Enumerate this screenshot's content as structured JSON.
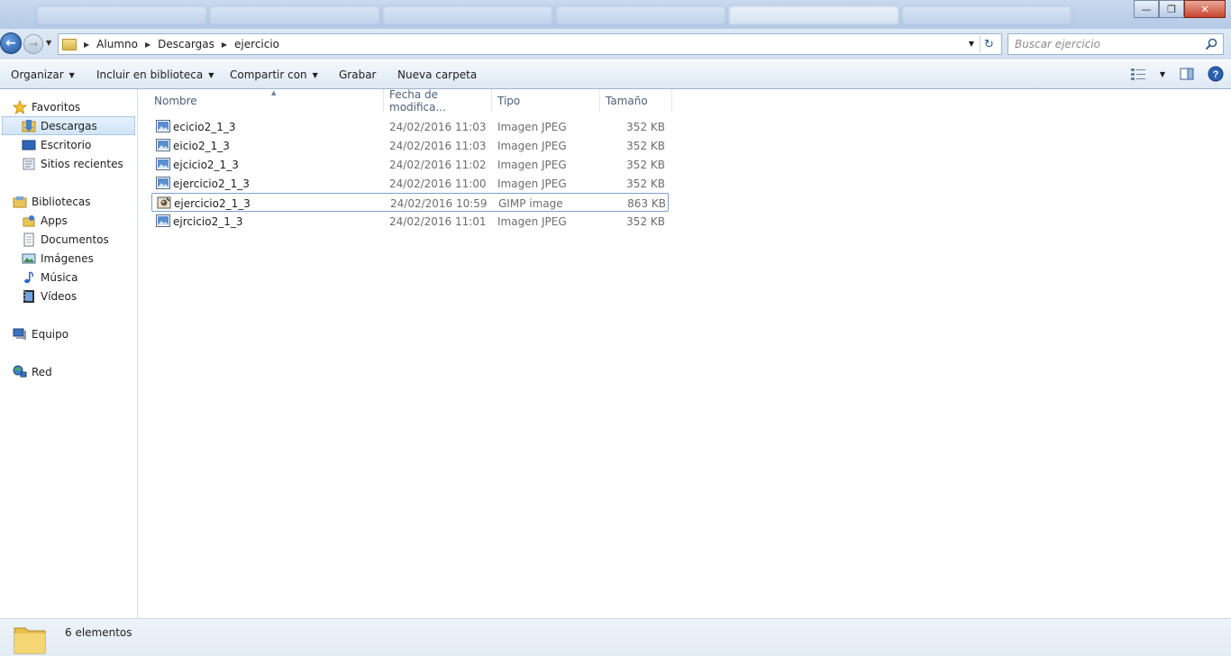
{
  "window": {
    "tabs": [
      "",
      "",
      "",
      "",
      "",
      "",
      "",
      ""
    ],
    "minimize": "—",
    "restore": "❐",
    "close": "✕"
  },
  "address": {
    "breadcrumbs": [
      "Alumno",
      "Descargas",
      "ejercicio"
    ],
    "search_placeholder": "Buscar ejercicio"
  },
  "toolbar": {
    "organize": "Organizar",
    "include_library": "Incluir en biblioteca",
    "share": "Compartir con",
    "burn": "Grabar",
    "new_folder": "Nueva carpeta"
  },
  "sidebar": {
    "favorites": "Favoritos",
    "downloads": "Descargas",
    "desktop": "Escritorio",
    "recent": "Sitios recientes",
    "libraries": "Bibliotecas",
    "apps": "Apps",
    "documents": "Documentos",
    "images": "Imágenes",
    "music": "Música",
    "videos": "Vídeos",
    "computer": "Equipo",
    "network": "Red"
  },
  "columns": {
    "name": "Nombre",
    "date": "Fecha de modifica...",
    "type": "Tipo",
    "size": "Tamaño"
  },
  "files": [
    {
      "name": "ecicio2_1_3",
      "date": "24/02/2016 11:03",
      "type": "Imagen JPEG",
      "size": "352 KB",
      "icon": "jpeg-image-icon"
    },
    {
      "name": "eicio2_1_3",
      "date": "24/02/2016 11:03",
      "type": "Imagen JPEG",
      "size": "352 KB",
      "icon": "jpeg-image-icon"
    },
    {
      "name": "ejcicio2_1_3",
      "date": "24/02/2016 11:02",
      "type": "Imagen JPEG",
      "size": "352 KB",
      "icon": "jpeg-image-icon"
    },
    {
      "name": "ejercicio2_1_3",
      "date": "24/02/2016 11:00",
      "type": "Imagen JPEG",
      "size": "352 KB",
      "icon": "jpeg-image-icon"
    },
    {
      "name": "ejercicio2_1_3",
      "date": "24/02/2016 10:59",
      "type": "GIMP image",
      "size": "863 KB",
      "icon": "gimp-image-icon"
    },
    {
      "name": "ejrcicio2_1_3",
      "date": "24/02/2016 11:01",
      "type": "Imagen JPEG",
      "size": "352 KB",
      "icon": "jpeg-image-icon"
    }
  ],
  "status": {
    "count": "6 elementos"
  }
}
